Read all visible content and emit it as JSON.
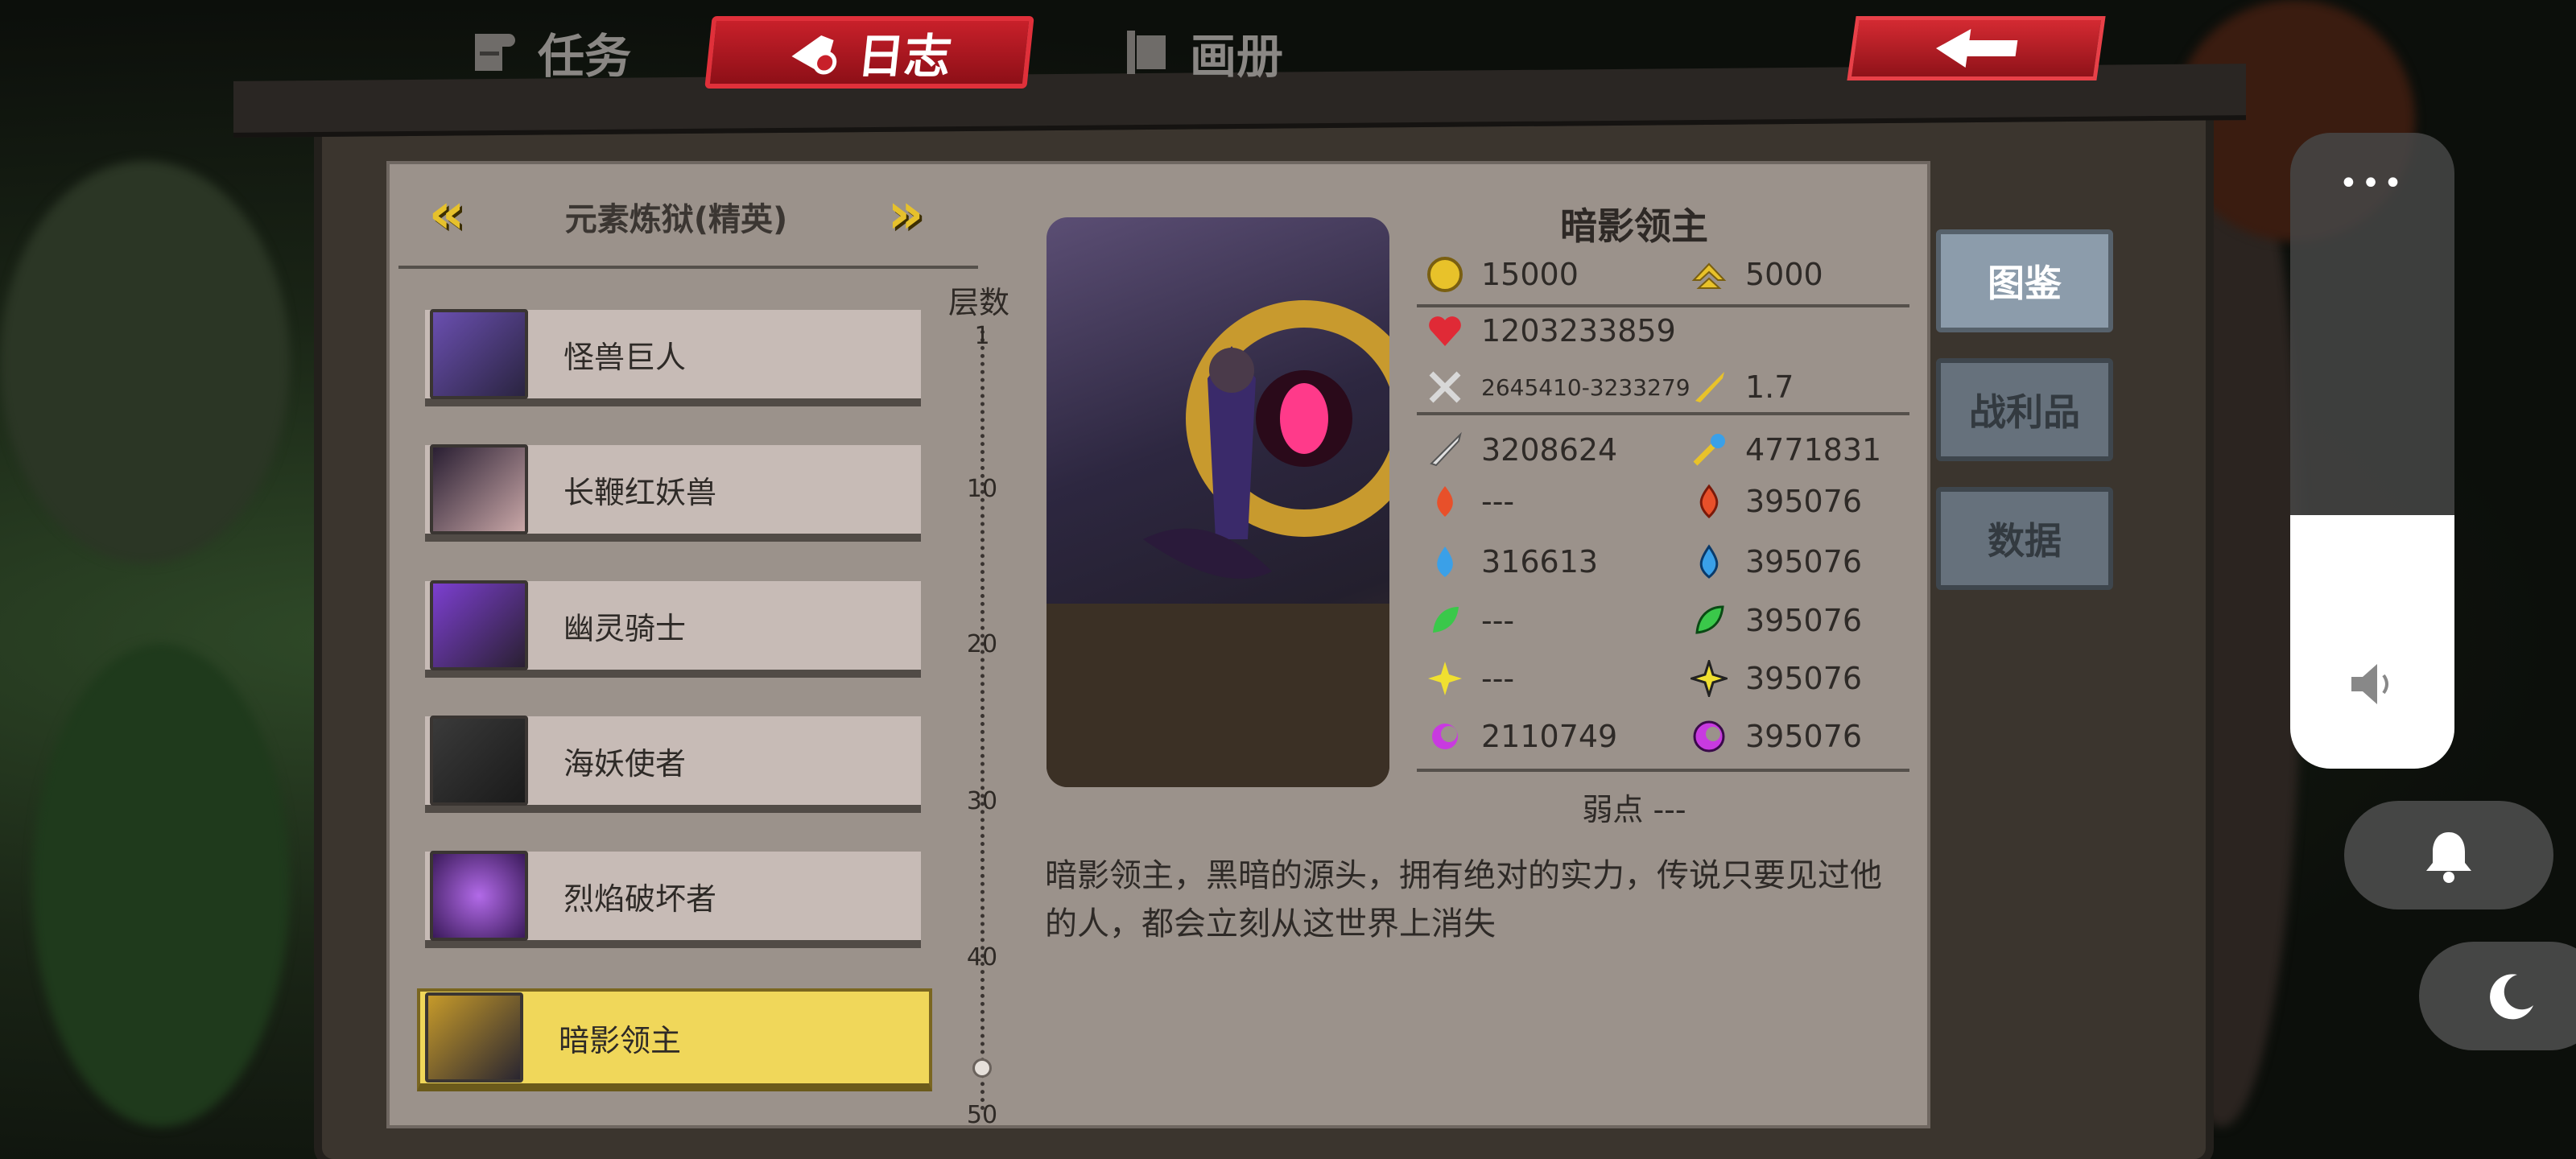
{
  "tabs": {
    "task": "任务",
    "journal": "日志",
    "album": "画册"
  },
  "chapter": {
    "title": "元素炼狱(精英)"
  },
  "monsters": [
    {
      "name": "怪兽巨人",
      "icon": "golem-portrait"
    },
    {
      "name": "长鞭红妖兽",
      "icon": "red-demon-portrait"
    },
    {
      "name": "幽灵骑士",
      "icon": "ghost-knight-portrait"
    },
    {
      "name": "海妖使者",
      "icon": "sea-demon-portrait"
    },
    {
      "name": "烈焰破坏者",
      "icon": "flame-destroyer-portrait"
    },
    {
      "name": "暗影领主",
      "icon": "shadow-lord-portrait",
      "selected": true
    }
  ],
  "depth": {
    "label": "层数",
    "ticks": [
      "1",
      "10",
      "20",
      "30",
      "40",
      "50"
    ]
  },
  "boss": {
    "name": "暗影领主",
    "gold": "15000",
    "exp": "5000",
    "hp": "1203233859",
    "attack": "2645410-3233279",
    "crit": "1.7",
    "phys_def": "3208624",
    "magic_pen": "4771831",
    "fire_atk": "---",
    "fire_res": "395076",
    "water_atk": "316613",
    "water_res": "395076",
    "wind_atk": "---",
    "wind_res": "395076",
    "light_atk": "---",
    "light_res": "395076",
    "dark_atk": "2110749",
    "dark_res": "395076",
    "weakness": "弱点 ---",
    "description": "暗影领主，黑暗的源头，拥有绝对的实力，传说只要见过他的人，都会立刻从这世界上消失"
  },
  "side_tabs": {
    "codex": "图鉴",
    "loot": "战利品",
    "data": "数据"
  },
  "system": {
    "more": "•••"
  },
  "colors": {
    "accent_red": "#c8202a",
    "selected_yellow": "#f0d75a",
    "panel": "#9b928b"
  }
}
